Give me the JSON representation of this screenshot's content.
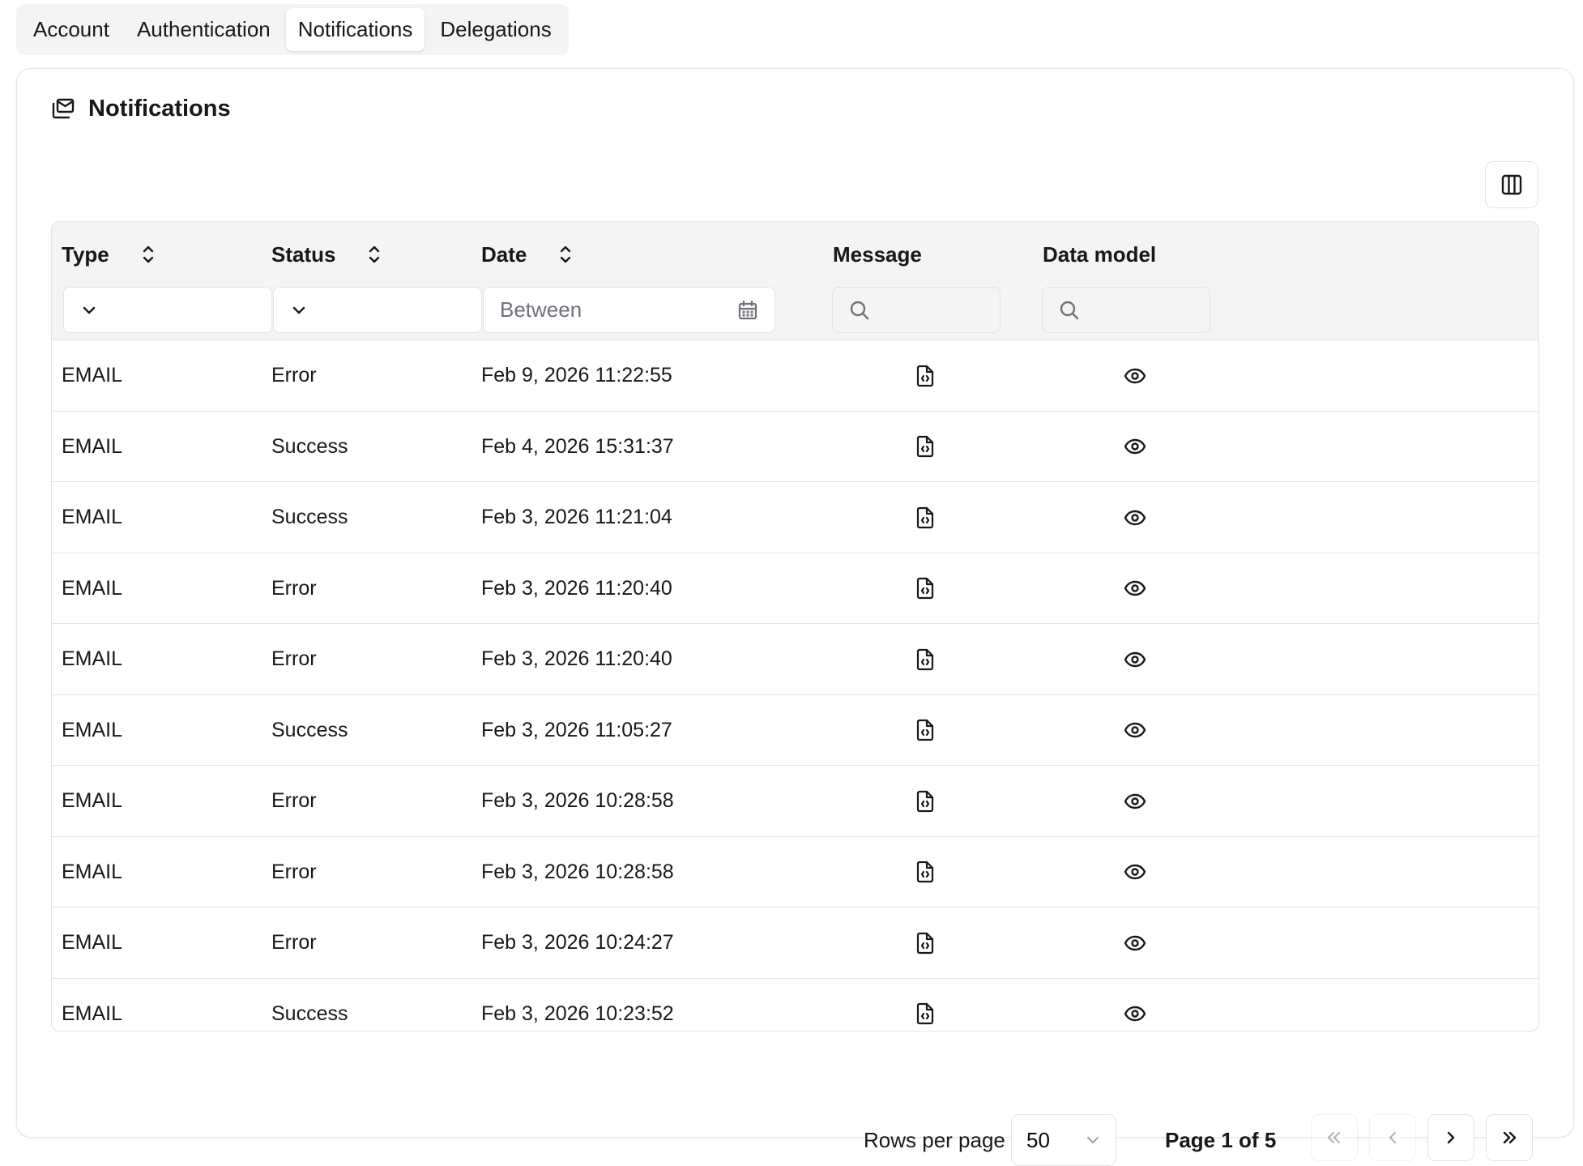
{
  "tabs": [
    {
      "label": "Account"
    },
    {
      "label": "Authentication"
    },
    {
      "label": "Notifications"
    },
    {
      "label": "Delegations"
    }
  ],
  "active_tab": "Notifications",
  "card": {
    "title": "Notifications",
    "title_icon": "mail-stack-icon"
  },
  "toolbar": {
    "columns_icon": "columns-icon"
  },
  "table": {
    "headers": {
      "type": "Type",
      "status": "Status",
      "date": "Date",
      "message": "Message",
      "data_model": "Data model"
    },
    "filters": {
      "type_value": "",
      "status_value": "",
      "date_placeholder": "Between",
      "message_placeholder": "",
      "data_model_placeholder": ""
    },
    "rows": [
      {
        "type": "EMAIL",
        "status": "Error",
        "date": "Feb 9, 2026 11:22:55"
      },
      {
        "type": "EMAIL",
        "status": "Success",
        "date": "Feb 4, 2026 15:31:37"
      },
      {
        "type": "EMAIL",
        "status": "Success",
        "date": "Feb 3, 2026 11:21:04"
      },
      {
        "type": "EMAIL",
        "status": "Error",
        "date": "Feb 3, 2026 11:20:40"
      },
      {
        "type": "EMAIL",
        "status": "Error",
        "date": "Feb 3, 2026 11:20:40"
      },
      {
        "type": "EMAIL",
        "status": "Success",
        "date": "Feb 3, 2026 11:05:27"
      },
      {
        "type": "EMAIL",
        "status": "Error",
        "date": "Feb 3, 2026 10:28:58"
      },
      {
        "type": "EMAIL",
        "status": "Error",
        "date": "Feb 3, 2026 10:28:58"
      },
      {
        "type": "EMAIL",
        "status": "Error",
        "date": "Feb 3, 2026 10:24:27"
      },
      {
        "type": "EMAIL",
        "status": "Success",
        "date": "Feb 3, 2026 10:23:52"
      }
    ]
  },
  "pagination": {
    "rows_per_page_label": "Rows per page",
    "rows_per_page_value": "50",
    "page_label": "Page 1 of 5"
  }
}
